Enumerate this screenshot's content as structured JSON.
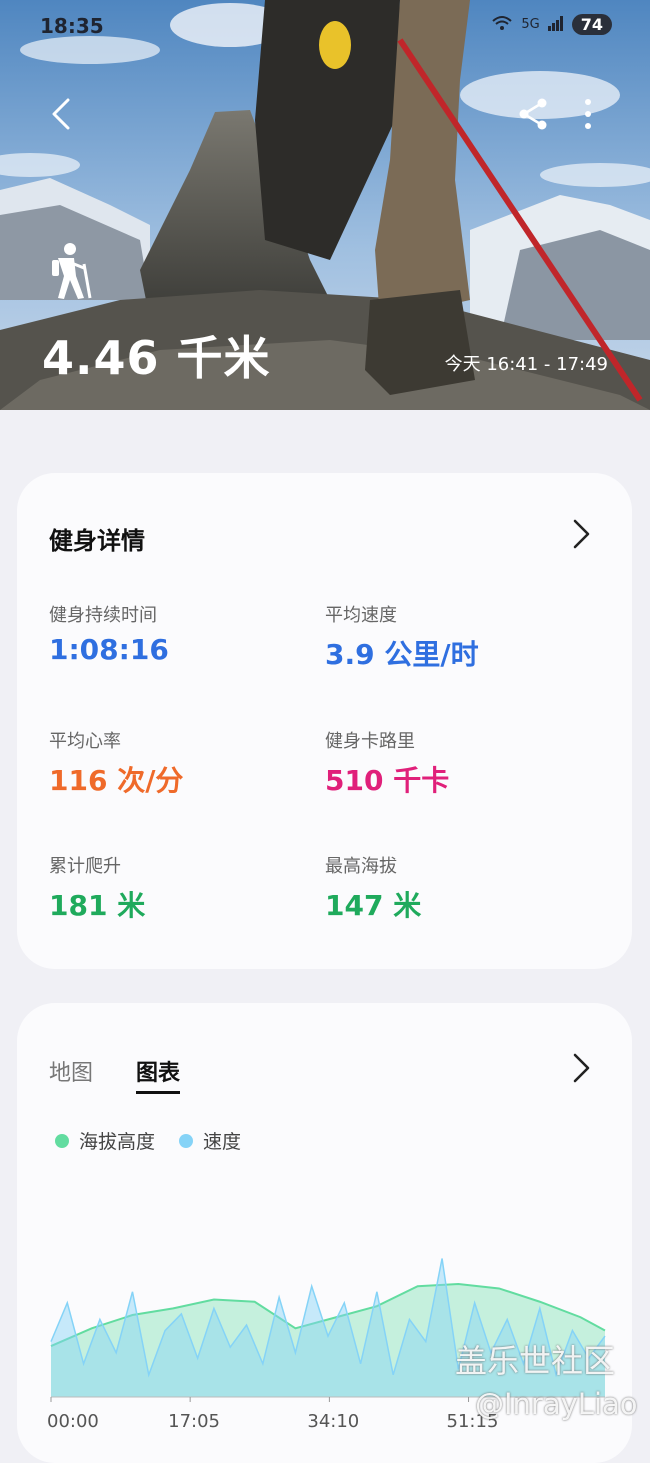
{
  "status_bar": {
    "time": "18:35",
    "signal": "5G",
    "battery": "74"
  },
  "hero": {
    "distance": "4.46 千米",
    "time_range": "今天 16:41 - 17:49",
    "activity_icon": "hiking-icon"
  },
  "details": {
    "title": "健身详情",
    "metrics": [
      {
        "label": "健身持续时间",
        "value": "1:08:16",
        "color": "#2f6fe0"
      },
      {
        "label": "平均速度",
        "value": "3.9 公里/时",
        "color": "#2f6fe0"
      },
      {
        "label": "平均心率",
        "value": "116 次/分",
        "color": "#ef6a2a"
      },
      {
        "label": "健身卡路里",
        "value": "510 千卡",
        "color": "#e0207a"
      },
      {
        "label": "累计爬升",
        "value": "181 米",
        "color": "#1faa5c"
      },
      {
        "label": "最高海拔",
        "value": "147 米",
        "color": "#1faa5c"
      }
    ]
  },
  "chart_panel": {
    "tabs": [
      "地图",
      "图表"
    ],
    "active_tab": "图表",
    "legend": [
      {
        "name": "海拔高度",
        "color": "#62dca0"
      },
      {
        "name": "速度",
        "color": "#85d3f7"
      }
    ]
  },
  "chart_data": {
    "type": "area",
    "x_ticks": [
      "00:00",
      "17:05",
      "34:10",
      "51:15"
    ],
    "series": [
      {
        "name": "海拔高度",
        "x": [
          0,
          5,
          10,
          15,
          20,
          25,
          30,
          35,
          40,
          45,
          50,
          55,
          60,
          65,
          68
        ],
        "values": [
          46,
          62,
          74,
          80,
          88,
          86,
          62,
          72,
          82,
          100,
          102,
          98,
          86,
          72,
          60
        ]
      },
      {
        "name": "速度",
        "x": [
          0,
          2,
          4,
          6,
          8,
          10,
          12,
          14,
          16,
          18,
          20,
          22,
          24,
          26,
          28,
          30,
          32,
          34,
          36,
          38,
          40,
          42,
          44,
          46,
          48,
          50,
          52,
          54,
          56,
          58,
          60,
          62,
          64,
          66,
          68
        ],
        "values": [
          50,
          85,
          30,
          70,
          40,
          95,
          20,
          60,
          75,
          35,
          80,
          45,
          65,
          30,
          90,
          40,
          100,
          55,
          85,
          30,
          95,
          20,
          70,
          50,
          125,
          25,
          85,
          40,
          70,
          30,
          80,
          20,
          60,
          35,
          55
        ]
      }
    ],
    "ylim": [
      0,
      130
    ]
  },
  "watermark": {
    "line1": "盖乐世社区",
    "line2": "@InrayLiao"
  }
}
